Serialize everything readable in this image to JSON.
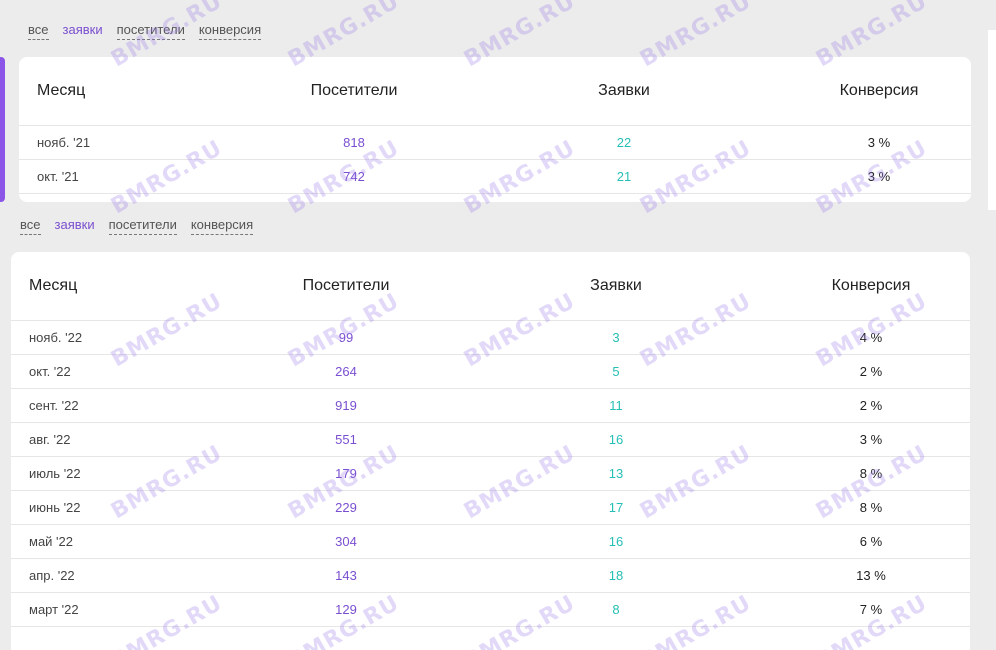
{
  "colors": {
    "accent": "#7a4fd0",
    "teal": "#26bfb5",
    "background": "#ececec"
  },
  "watermark": "BMRG.RU",
  "table1": {
    "filters": [
      "все",
      "заявки",
      "посетители",
      "конверсия"
    ],
    "active_filter": "заявки",
    "headers": {
      "month": "Месяц",
      "visitors": "Посетители",
      "requests": "Заявки",
      "conversion": "Конверсия"
    },
    "rows": [
      {
        "month": "нояб. '21",
        "visitors": "818",
        "requests": "22",
        "conversion": "3 %"
      },
      {
        "month": "окт. '21",
        "visitors": "742",
        "requests": "21",
        "conversion": "3 %"
      }
    ]
  },
  "table2": {
    "filters": [
      "все",
      "заявки",
      "посетители",
      "конверсия"
    ],
    "active_filter": "заявки",
    "headers": {
      "month": "Месяц",
      "visitors": "Посетители",
      "requests": "Заявки",
      "conversion": "Конверсия"
    },
    "rows": [
      {
        "month": "нояб. '22",
        "visitors": "99",
        "requests": "3",
        "conversion": "4 %"
      },
      {
        "month": "окт. '22",
        "visitors": "264",
        "requests": "5",
        "conversion": "2 %"
      },
      {
        "month": "сент. '22",
        "visitors": "919",
        "requests": "11",
        "conversion": "2 %"
      },
      {
        "month": "авг. '22",
        "visitors": "551",
        "requests": "16",
        "conversion": "3 %"
      },
      {
        "month": "июль '22",
        "visitors": "179",
        "requests": "13",
        "conversion": "8 %"
      },
      {
        "month": "июнь '22",
        "visitors": "229",
        "requests": "17",
        "conversion": "8 %"
      },
      {
        "month": "май '22",
        "visitors": "304",
        "requests": "16",
        "conversion": "6 %"
      },
      {
        "month": "апр. '22",
        "visitors": "143",
        "requests": "18",
        "conversion": "13 %"
      },
      {
        "month": "март '22",
        "visitors": "129",
        "requests": "8",
        "conversion": "7 %"
      }
    ]
  }
}
